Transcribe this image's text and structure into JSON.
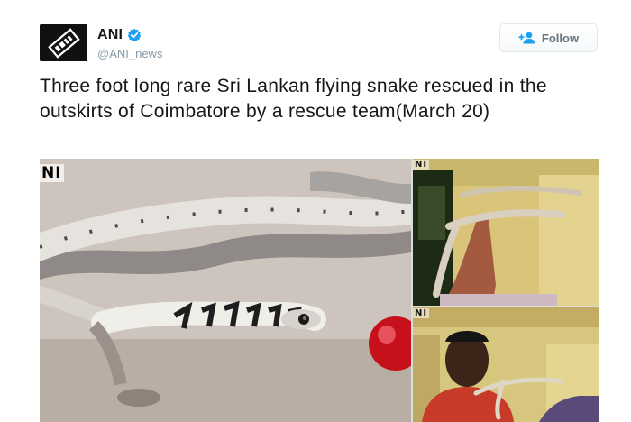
{
  "tweet": {
    "display_name": "ANI",
    "handle": "@ANI_news",
    "follow_label": "Follow",
    "text": "Three foot long rare Sri Lankan flying snake rescued in the outskirts of Coimbatore by a rescue team(March 20)"
  },
  "media": {
    "watermark_main": "NI",
    "watermark_top_right": "NI",
    "watermark_bottom_right": "NI"
  },
  "colors": {
    "verified": "#1da1f2",
    "follow_icon": "#1da1f2"
  },
  "icons": {
    "avatar": "ani-logo",
    "verified": "verified-badge-icon",
    "follow": "add-user-icon"
  }
}
